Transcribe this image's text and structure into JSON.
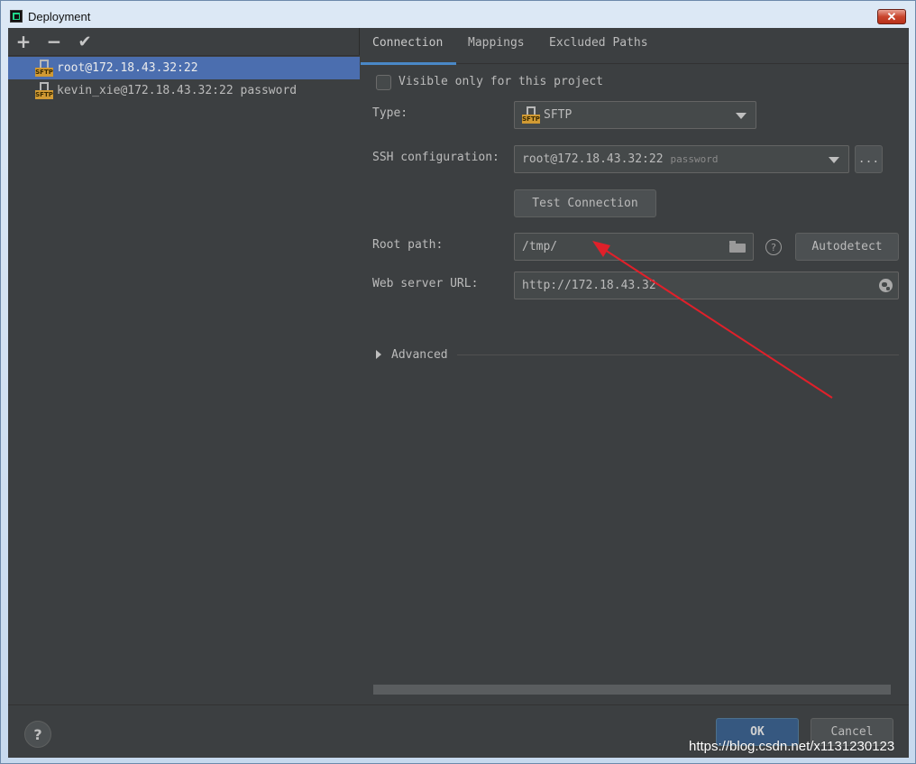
{
  "window": {
    "title": "Deployment",
    "close_label": "✕"
  },
  "toolbar": {
    "add_label": "+",
    "remove_label": "−",
    "apply_label": "✔"
  },
  "servers": [
    {
      "label": "root@172.18.43.32:22",
      "selected": true,
      "icon": "sftp-icon"
    },
    {
      "label": "kevin_xie@172.18.43.32:22 password",
      "selected": false,
      "icon": "sftp-icon"
    }
  ],
  "tabs": [
    {
      "label": "Connection",
      "active": true
    },
    {
      "label": "Mappings",
      "active": false
    },
    {
      "label": "Excluded Paths",
      "active": false
    }
  ],
  "connection": {
    "visible_only_label": "Visible only for this project",
    "visible_only_checked": false,
    "type_label": "Type:",
    "type_value": "SFTP",
    "ssh_label": "SSH configuration:",
    "ssh_value": "root@172.18.43.32:22",
    "ssh_hint": "password",
    "ssh_more_label": "...",
    "test_connection_label": "Test Connection",
    "root_path_label": "Root path:",
    "root_path_value": "/tmp/",
    "help_label": "?",
    "autodetect_label": "Autodetect",
    "web_url_label": "Web server URL:",
    "web_url_value": "http://172.18.43.32",
    "advanced_label": "Advanced"
  },
  "footer": {
    "help_label": "?",
    "ok_label": "OK",
    "cancel_label": "Cancel"
  },
  "watermark": "https://blog.csdn.net/x1131230123",
  "colors": {
    "background": "#3c3f41",
    "selection": "#4b6eaf",
    "accent_tab": "#4a88c7",
    "annotation_arrow": "#e0202a"
  }
}
